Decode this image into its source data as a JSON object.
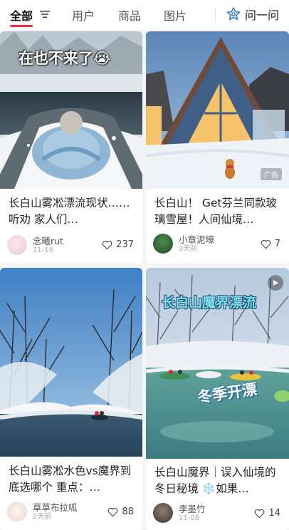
{
  "tabs": [
    {
      "label": "全部"
    },
    {
      "label": "用户"
    },
    {
      "label": "商品"
    },
    {
      "label": "图片"
    }
  ],
  "ask": {
    "label": "问一问"
  },
  "colors": {
    "accent": "#ff2442",
    "ask_icon": "#2a7bd6"
  },
  "icons": {
    "filter": "filter-icon",
    "ask": "ask-star-icon",
    "like": "heart-outline-icon",
    "play": "play-icon"
  },
  "cards": [
    {
      "overlay": "在也不来了😭",
      "title": "长白山雾凇漂流现状……听劝 家人们…",
      "author": "念曦rut",
      "date": "11-16",
      "likes": "237"
    },
    {
      "badge": "广告",
      "title": "长白山！ Get芬兰同款玻璃雪屋！人间仙境…",
      "author": "小章泥壕",
      "date": "3天前",
      "likes": "7"
    },
    {
      "title": "长白山雾凇水色vs魔界到底选哪个 重点：…",
      "author": "草草布拉呱",
      "date": "2天前",
      "likes": "88"
    },
    {
      "overlay": "长白山魔界漂流",
      "overlay2": "冬季开漂",
      "title": "长白山魔界｜误入仙境的冬日秘境 ❄️如果…",
      "author": "李墨竹",
      "date": "11-08",
      "likes": "14"
    }
  ]
}
